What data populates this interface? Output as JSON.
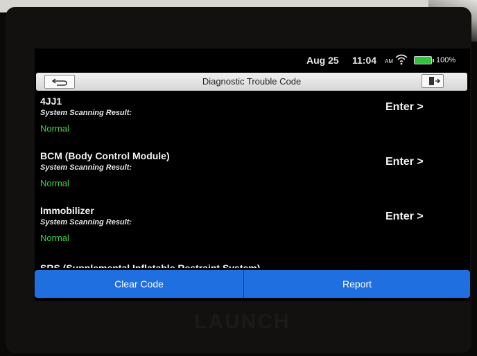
{
  "statusbar": {
    "date": "Aug 25",
    "time": "11:04",
    "ampm": "AM",
    "battery_pct": "100%",
    "battery_level": 1.0,
    "wifi_icon": "wifi-icon",
    "battery_icon": "battery-icon"
  },
  "titlebar": {
    "title": "Diagnostic Trouble Code",
    "back_icon": "back-arrow-icon",
    "exit_icon": "exit-icon"
  },
  "items": [
    {
      "name": "4JJ1",
      "sub": "System Scanning Result:",
      "status": "Normal",
      "enter": "Enter >"
    },
    {
      "name": "BCM (Body Control Module)",
      "sub": "System Scanning Result:",
      "status": "Normal",
      "enter": "Enter >"
    },
    {
      "name": "Immobilizer",
      "sub": "System Scanning Result:",
      "status": "Normal",
      "enter": "Enter >"
    }
  ],
  "partial_item": "SRS (Supplemental Inflatable Restraint System)",
  "buttons": {
    "clear": "Clear Code",
    "report": "Report"
  },
  "brand": "LAUNCH",
  "colors": {
    "accent_blue": "#1f6fe0",
    "status_green": "#3cd048",
    "battery_green": "#2ec43c"
  }
}
